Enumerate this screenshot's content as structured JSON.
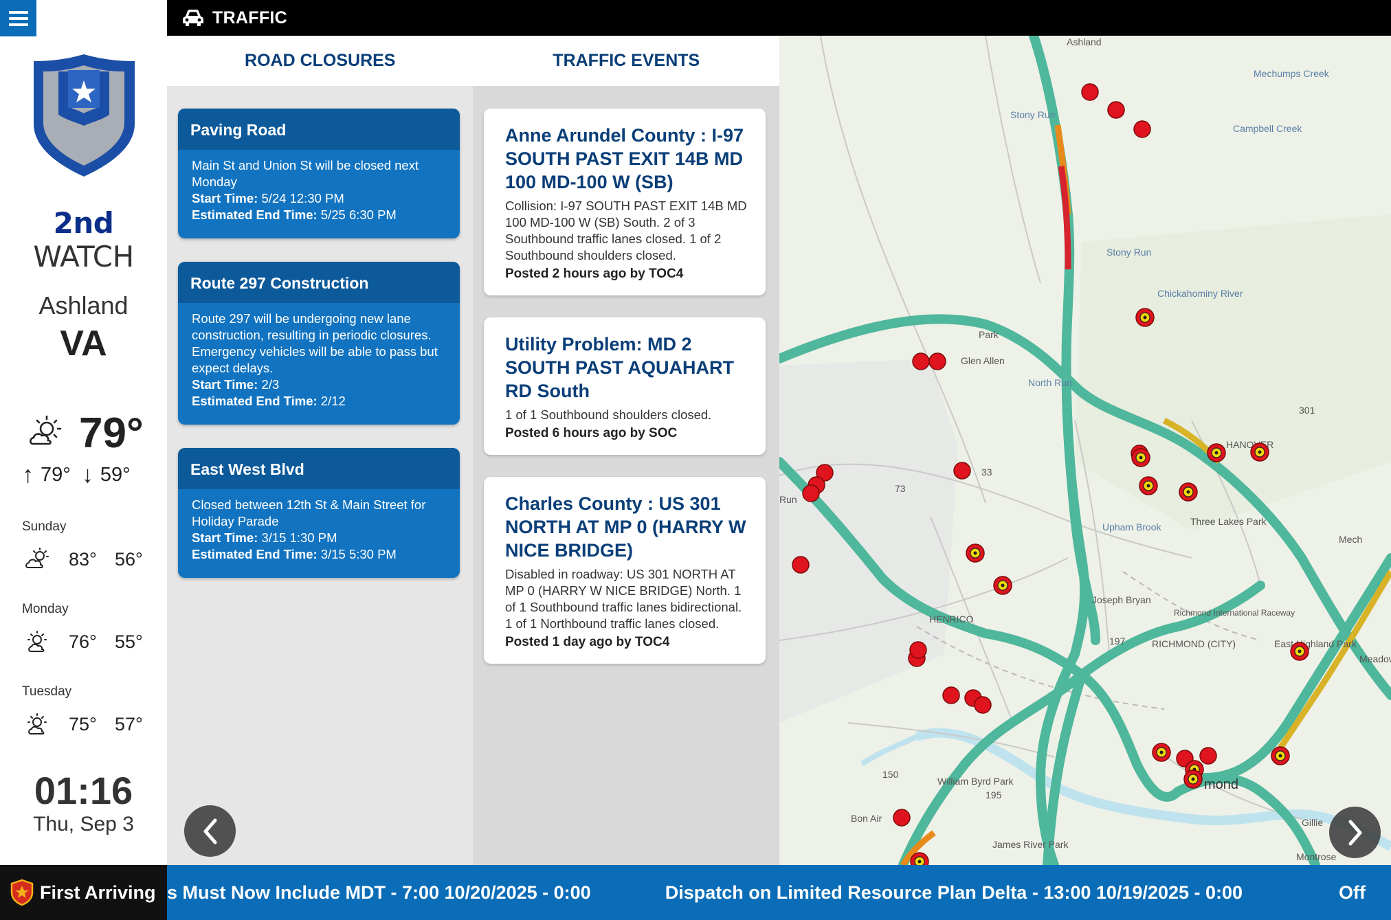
{
  "app": {
    "section_title": "TRAFFIC"
  },
  "brand": {
    "strong": "2nd",
    "rest": " WATCH"
  },
  "location": {
    "city": "Ashland",
    "state": "VA"
  },
  "weather": {
    "current_temp": "79°",
    "high": "79°",
    "low": "59°",
    "forecast": [
      {
        "day": "Sunday",
        "icon": "partly-cloudy-icon",
        "high": "83°",
        "low": "56°"
      },
      {
        "day": "Monday",
        "icon": "sun-cloud-icon",
        "high": "76°",
        "low": "55°"
      },
      {
        "day": "Tuesday",
        "icon": "sun-cloud-icon",
        "high": "75°",
        "low": "57°"
      }
    ]
  },
  "clock": {
    "time": "01:16",
    "date": "Thu, Sep 3"
  },
  "tabs": [
    {
      "label": "ROAD CLOSURES"
    },
    {
      "label": "TRAFFIC EVENTS"
    }
  ],
  "closures": [
    {
      "title": "Paving Road",
      "description": "Main St and Union St will be closed next Monday",
      "start_label": "Start Time:",
      "start": "5/24 12:30 PM",
      "end_label": "Estimated End Time:",
      "end": "5/25 6:30 PM"
    },
    {
      "title": "Route 297 Construction",
      "description": "Route 297 will be undergoing new lane construction, resulting in periodic closures. Emergency vehicles will be able to pass but expect delays.",
      "start_label": "Start Time:",
      "start": "2/3",
      "end_label": "Estimated End Time:",
      "end": "2/12"
    },
    {
      "title": "East West Blvd",
      "description": "Closed between 12th St & Main Street for Holiday Parade",
      "start_label": "Start Time:",
      "start": "3/15 1:30 PM",
      "end_label": "Estimated End Time:",
      "end": "3/15 5:30 PM"
    }
  ],
  "events": [
    {
      "title": "Anne Arundel County : I-97 SOUTH PAST EXIT 14B MD 100 MD-100 W (SB)",
      "description": "Collision: I-97 SOUTH PAST EXIT 14B MD 100 MD-100 W (SB) South. 2 of 3 Southbound traffic lanes closed. 1 of 2 Southbound shoulders closed.",
      "posted": "Posted 2 hours ago by TOC4"
    },
    {
      "title": "Utility Problem: MD 2 SOUTH PAST AQUAHART RD South",
      "description": "1 of 1 Southbound shoulders closed.",
      "posted": "Posted 6 hours ago by SOC"
    },
    {
      "title": "Charles County : US 301 NORTH AT MP 0 (HARRY W NICE BRIDGE)",
      "description": "Disabled in roadway: US 301 NORTH AT MP 0 (HARRY W NICE BRIDGE) North. 1 of 1 Southbound traffic lanes bidirectional. 1 of 1 Northbound traffic lanes closed.",
      "posted": "Posted 1 day ago by TOC4"
    }
  ],
  "map": {
    "place_labels": [
      "Ashland",
      "Mechumps Creek",
      "Stony Run",
      "Campbell Creek",
      "Stony Run",
      "Chickahominy River",
      "Park",
      "Glen Allen",
      "North Run",
      "301",
      "HANOVER",
      "73",
      "33",
      "Run",
      "Upham Brook",
      "Three Lakes Park",
      "Mech",
      "HENRICO",
      "Joseph Bryan",
      "197",
      "Richmond International Raceway",
      "RICHMOND (CITY)",
      "East Highland Park",
      "Meadow",
      "150",
      "195",
      "William Byrd Park",
      "mond",
      "Bon Air",
      "James River Park",
      "Montrose",
      "Gillie"
    ],
    "colors": {
      "highway": "#4fb79b",
      "congestion_red": "#d7232e",
      "congestion_orange": "#e88a1a",
      "slow_yellow": "#d8b328",
      "incident_red": "#e0141e"
    }
  },
  "ticker": {
    "brand": "First Arriving",
    "items": [
      "s Must Now Include MDT - 7:00 10/20/2025 - 0:00",
      "Dispatch on Limited Resource Plan Delta - 13:00 10/19/2025 - 0:00",
      "Off"
    ]
  }
}
